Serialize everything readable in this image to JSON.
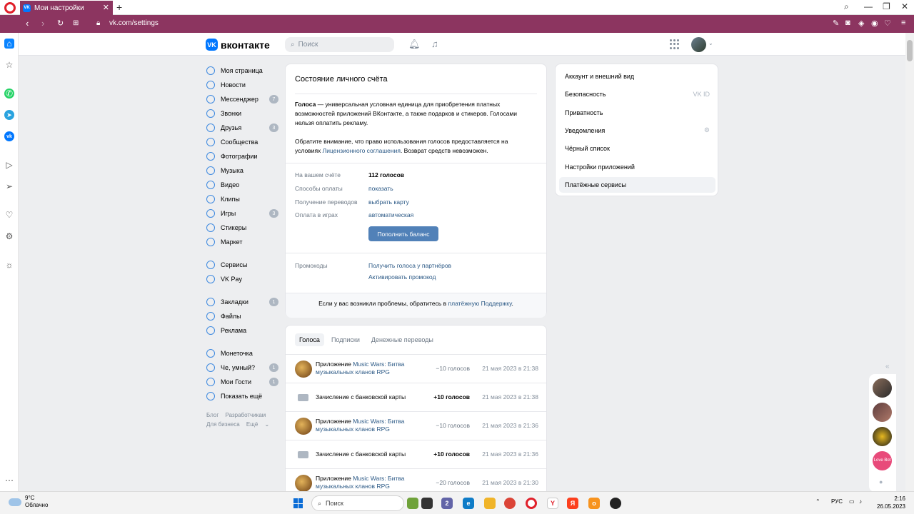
{
  "browser": {
    "tab_title": "Мои настройки",
    "tab_favicon": "VK",
    "url": "vk.com/settings"
  },
  "header": {
    "logo_mark": "VK",
    "logo_text": "вконтакте",
    "search_placeholder": "Поиск"
  },
  "leftmenu": {
    "items": [
      {
        "label": "Моя страница",
        "badge": ""
      },
      {
        "label": "Новости",
        "badge": ""
      },
      {
        "label": "Мессенджер",
        "badge": "7"
      },
      {
        "label": "Звонки",
        "badge": ""
      },
      {
        "label": "Друзья",
        "badge": "3"
      },
      {
        "label": "Сообщества",
        "badge": ""
      },
      {
        "label": "Фотографии",
        "badge": ""
      },
      {
        "label": "Музыка",
        "badge": ""
      },
      {
        "label": "Видео",
        "badge": ""
      },
      {
        "label": "Клипы",
        "badge": ""
      },
      {
        "label": "Игры",
        "badge": "3"
      },
      {
        "label": "Стикеры",
        "badge": ""
      },
      {
        "label": "Маркет",
        "badge": ""
      }
    ],
    "items2": [
      {
        "label": "Сервисы",
        "badge": ""
      },
      {
        "label": "VK Pay",
        "badge": ""
      }
    ],
    "items3": [
      {
        "label": "Закладки",
        "badge": "1"
      },
      {
        "label": "Файлы",
        "badge": ""
      },
      {
        "label": "Реклама",
        "badge": ""
      }
    ],
    "items4": [
      {
        "label": "Монеточка",
        "badge": ""
      },
      {
        "label": "Че, умный?",
        "badge": "1"
      },
      {
        "label": "Мои Гости",
        "badge": "1"
      },
      {
        "label": "Показать ещё",
        "badge": ""
      }
    ],
    "footer": {
      "blog": "Блог",
      "devs": "Разработчикам",
      "business": "Для бизнеса",
      "more": "Ещё"
    }
  },
  "balance": {
    "title": "Состояние личного счёта",
    "p1_bold": "Голоса",
    "p1_rest": " — универсальная условная единица для приобретения платных возможностей приложений ВКонтакте, а также подарков и стикеров. Голосами нельзя оплатить рекламу.",
    "p2_start": "Обратите внимание, что право использования голосов предоставляется на условиях ",
    "p2_link": "Лицензионного соглашения",
    "p2_end": ". Возврат средств невозможен.",
    "rows": [
      {
        "key": "На вашем счёте",
        "value": "112 голосов"
      },
      {
        "key": "Способы оплаты",
        "value": "показать"
      },
      {
        "key": "Получение переводов",
        "value": "выбрать карту"
      },
      {
        "key": "Оплата в играх",
        "value": "автоматическая"
      }
    ],
    "topup_button": "Пополнить баланс",
    "promo_key": "Промокоды",
    "promo_link1": "Получить голоса у партнёров",
    "promo_link2": "Активировать промокод",
    "support_text": "Если у вас возникли проблемы, обратитесь в ",
    "support_link": "платёжную Поддержку",
    "support_end": "."
  },
  "history": {
    "tabs": [
      "Голоса",
      "Подписки",
      "Денежные переводы"
    ],
    "rows": [
      {
        "prefix": "Приложение ",
        "link": "Music Wars: Битва музыкальных кланов RPG",
        "amount": "−10 голосов",
        "date": "21 мая 2023 в 21:38",
        "kind": "app"
      },
      {
        "prefix": "Зачисление с банковской карты",
        "link": "",
        "amount": "+10 голосов",
        "date": "21 мая 2023 в 21:38",
        "kind": "card"
      },
      {
        "prefix": "Приложение ",
        "link": "Music Wars: Битва музыкальных кланов RPG",
        "amount": "−10 голосов",
        "date": "21 мая 2023 в 21:36",
        "kind": "app"
      },
      {
        "prefix": "Зачисление с банковской карты",
        "link": "",
        "amount": "+10 голосов",
        "date": "21 мая 2023 в 21:36",
        "kind": "card"
      },
      {
        "prefix": "Приложение ",
        "link": "Music Wars: Битва музыкальных кланов RPG",
        "amount": "−20 голосов",
        "date": "21 мая 2023 в 21:30",
        "kind": "app"
      }
    ]
  },
  "settings_nav": {
    "items": [
      {
        "label": "Аккаунт и внешний вид",
        "extra": ""
      },
      {
        "label": "Безопасность",
        "extra": "VK ID"
      },
      {
        "label": "Приватность",
        "extra": ""
      },
      {
        "label": "Уведомления",
        "extra": "⚙"
      },
      {
        "label": "Чёрный список",
        "extra": ""
      },
      {
        "label": "Настройки приложений",
        "extra": ""
      },
      {
        "label": "Платёжные сервисы",
        "extra": ""
      }
    ]
  },
  "chat": {
    "love_bot": "Love Bot"
  },
  "taskbar": {
    "temp": "9°C",
    "weather": "Облачно",
    "search": "Поиск",
    "lang": "РУС",
    "time": "2:16",
    "date": "26.05.2023",
    "chat_badge": "2"
  }
}
